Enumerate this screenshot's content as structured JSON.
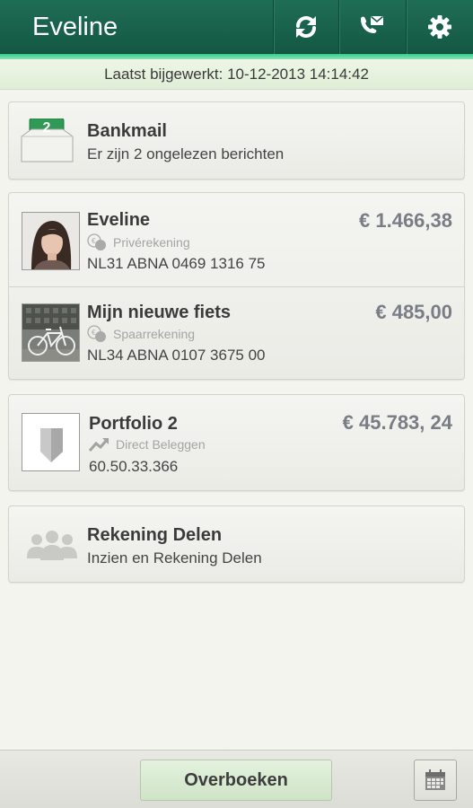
{
  "header": {
    "title": "Eveline",
    "buttons": [
      {
        "name": "refresh",
        "icon": "refresh-icon"
      },
      {
        "name": "contact",
        "icon": "phone-mail-icon"
      },
      {
        "name": "settings",
        "icon": "gear-icon"
      }
    ]
  },
  "status": {
    "last_updated": "Laatst bijgewerkt: 10-12-2013 14:14:42"
  },
  "bankmail": {
    "badge": "2",
    "title": "Bankmail",
    "subtitle": "Er zijn 2 ongelezen berichten",
    "icon": "mailbox-icon"
  },
  "accounts": [
    {
      "name": "Eveline",
      "type": "Privérekening",
      "iban": "NL31 ABNA 0469 1316 75",
      "amount": "€ 1.466,38",
      "thumb": "portrait-photo"
    },
    {
      "name": "Mijn nieuwe fiets",
      "type": "Spaarrekening",
      "iban": "NL34 ABNA 0107 3675 00",
      "amount": "€ 485,00",
      "thumb": "bicycle-photo"
    }
  ],
  "portfolio": {
    "name": "Portfolio 2",
    "type": "Direct Beleggen",
    "number": "60.50.33.366",
    "amount": "€ 45.783, 24",
    "thumb": "abn-shield-logo"
  },
  "share": {
    "title": "Rekening Delen",
    "subtitle": "Inzien en Rekening Delen",
    "icon": "people-group-icon"
  },
  "footer": {
    "transfer_label": "Overboeken",
    "calendar_icon": "calendar-icon"
  },
  "colors": {
    "header": "#175f48",
    "accent_green": "#2ecf8e",
    "amount_gray": "#7a7d86"
  }
}
